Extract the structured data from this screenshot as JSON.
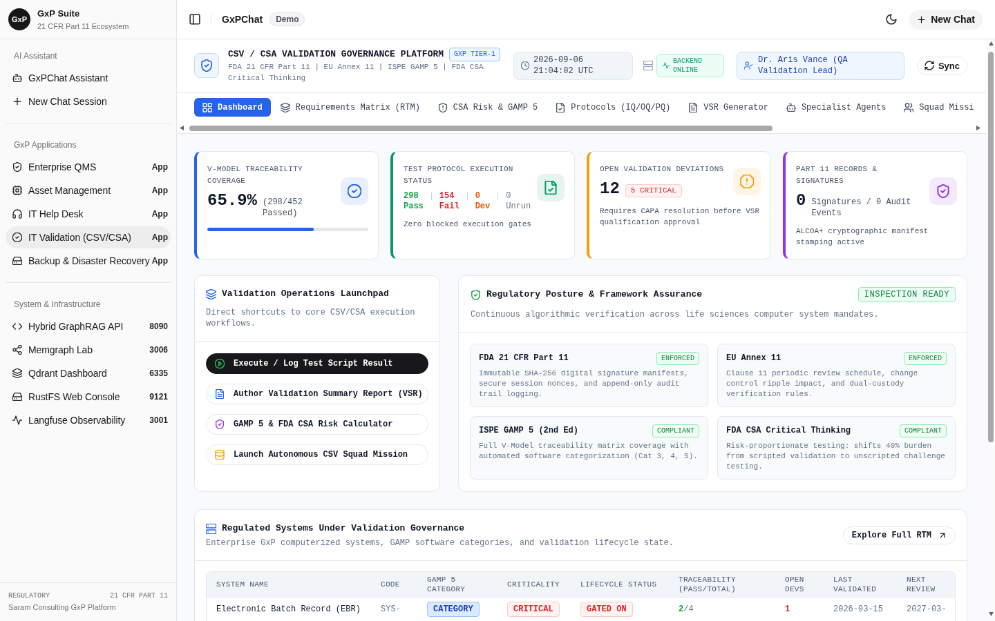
{
  "sidebar": {
    "logo": "GxP",
    "title": "GxP Suite",
    "subtitle": "21 CFR Part 11 Ecosystem",
    "sections": [
      {
        "heading": "AI Assistant",
        "items": [
          {
            "label": "GxPChat Assistant",
            "selected": false
          },
          {
            "label": "New Chat Session",
            "selected": false
          }
        ]
      },
      {
        "heading": "GxP Applications",
        "items": [
          {
            "label": "Enterprise QMS",
            "tag": "App",
            "selected": false
          },
          {
            "label": "Asset Management",
            "tag": "App",
            "selected": false
          },
          {
            "label": "IT Help Desk",
            "tag": "App",
            "selected": false
          },
          {
            "label": "IT Validation (CSV/CSA)",
            "tag": "App",
            "selected": true
          },
          {
            "label": "Backup & Disaster Recovery",
            "tag": "App",
            "selected": false
          }
        ]
      },
      {
        "heading": "System & Infrastructure",
        "items": [
          {
            "label": "Hybrid GraphRAG API",
            "tag": "8090",
            "selected": false
          },
          {
            "label": "Memgraph Lab",
            "tag": "3006",
            "selected": false
          },
          {
            "label": "Qdrant Dashboard",
            "tag": "6335",
            "selected": false
          },
          {
            "label": "RustFS Web Console",
            "tag": "9121",
            "selected": false
          },
          {
            "label": "Langfuse Observability",
            "tag": "3001",
            "selected": false
          }
        ]
      }
    ],
    "footer": {
      "label": "REGULATORY",
      "standard": "21 CFR PART 11",
      "platform": "Saram Consulting GxP Platform"
    }
  },
  "top_bar": {
    "title": "GxPChat",
    "badge": "Demo",
    "new_chat_button": "New Chat"
  },
  "platform_header": {
    "title": "CSV / CSA VALIDATION GOVERNANCE PLATFORM",
    "tier_badge": "GXP TIER-1",
    "frameworks": "FDA 21 CFR Part 11 | EU Annex 11 | ISPE GAMP 5 | FDA CSA Critical Thinking",
    "timestamp": "2026-09-06 21:04:02 UTC",
    "backend_status": "BACKEND ONLINE",
    "user": "Dr. Aris Vance (QA Validation Lead)",
    "sync_button": "Sync"
  },
  "tabs": [
    {
      "label": "Dashboard",
      "selected": true
    },
    {
      "label": "Requirements Matrix (RTM)",
      "selected": false
    },
    {
      "label": "CSA Risk & GAMP 5",
      "selected": false
    },
    {
      "label": "Protocols (IQ/OQ/PQ)",
      "selected": false
    },
    {
      "label": "VSR Generator",
      "selected": false
    },
    {
      "label": "Specialist Agents",
      "selected": false
    },
    {
      "label": "Squad Missi",
      "selected": false
    }
  ],
  "stat_cards": [
    {
      "kind": "progress",
      "label": "V-MODEL TRACEABILITY COVERAGE",
      "color": "#2563eb",
      "value": "65.9%",
      "detail": "(298/452 Passed)",
      "level": 0.659
    },
    {
      "kind": "breakdown",
      "label": "TEST PROTOCOL EXECUTION STATUS",
      "color": "#059669",
      "stats": [
        {
          "count": "298",
          "label": "Pass",
          "color": "#16a34a",
          "highlighted": true
        },
        {
          "count": "154",
          "label": "Fail",
          "color": "#dc2626",
          "highlighted": true
        },
        {
          "count": "0",
          "label": "Dev",
          "color": "#ea580c",
          "highlighted": true
        },
        {
          "count": "0",
          "label": "Unrun",
          "color": "#64748b",
          "highlighted": false
        }
      ],
      "note": "Zero blocked execution gates"
    },
    {
      "kind": "badge",
      "label": "OPEN VALIDATION DEVIATIONS",
      "color": "#f59e0b",
      "value": "12",
      "badge": "5 CRITICAL",
      "note": "Requires CAPA resolution before VSR qualification approval"
    },
    {
      "kind": "value",
      "label": "PART 11 RECORDS & SIGNATURES",
      "color": "#9333ea",
      "value": "0",
      "detail": "Signatures / 0 Audit Events",
      "note": "ALCOA+ cryptographic manifest stamping active"
    }
  ],
  "launchpad": {
    "title": "Validation Operations Launchpad",
    "description": "Direct shortcuts to core CSV/CSA execution workflows.",
    "actions": [
      {
        "label": "Execute / Log Test Script Result",
        "kind": "primary"
      },
      {
        "label": "Author Validation Summary Report (VSR)",
        "kind": "outline"
      },
      {
        "label": "GAMP 5 & FDA CSA Risk Calculator",
        "kind": "outline"
      },
      {
        "label": "Launch Autonomous CSV Squad Mission",
        "kind": "outline"
      }
    ]
  },
  "regulatory_posture": {
    "title": "Regulatory Posture & Framework Assurance",
    "status_badge": "INSPECTION READY",
    "description": "Continuous algorithmic verification across life sciences computer system mandates.",
    "frameworks": [
      {
        "name": "FDA 21 CFR Part 11",
        "status": "ENFORCED",
        "description": "Immutable SHA-256 digital signature manifests, secure session nonces, and append-only audit trail logging."
      },
      {
        "name": "EU Annex 11",
        "status": "ENFORCED",
        "description": "Clause 11 periodic review schedule, change control ripple impact, and dual-custody verification rules."
      },
      {
        "name": "ISPE GAMP 5 (2nd Ed)",
        "status": "COMPLIANT",
        "description": "Full V-Model traceability matrix coverage with automated software categorization (Cat 3, 4, 5)."
      },
      {
        "name": "FDA CSA Critical Thinking",
        "status": "COMPLIANT",
        "description": "Risk-proportionate testing: shifts 40% burden from scripted validation to unscripted challenge testing."
      }
    ]
  },
  "regulated_systems": {
    "title": "Regulated Systems Under Validation Governance",
    "description": "Enterprise GxP computerized systems, GAMP software categories, and validation lifecycle state.",
    "button": "Explore Full RTM",
    "table": {
      "columns": [
        "SYSTEM NAME",
        "CODE",
        "GAMP 5 CATEGORY",
        "CRITICALITY",
        "LIFECYCLE STATUS",
        "TRACEABILITY (PASS/TOTAL)",
        "OPEN DEVS",
        "LAST VALIDATED",
        "NEXT REVIEW"
      ],
      "rows": [
        {
          "system_name": "Electronic Batch Record (EBR)",
          "code": "SYS-",
          "gamp_category": "CATEGORY",
          "criticality": "CRITICAL",
          "lifecycle_status": "GATED ON",
          "traceability": "**2**/4",
          "open_devs": "1",
          "last_validated": "2026-03-15",
          "next_review": "2027-03-"
        }
      ]
    }
  }
}
